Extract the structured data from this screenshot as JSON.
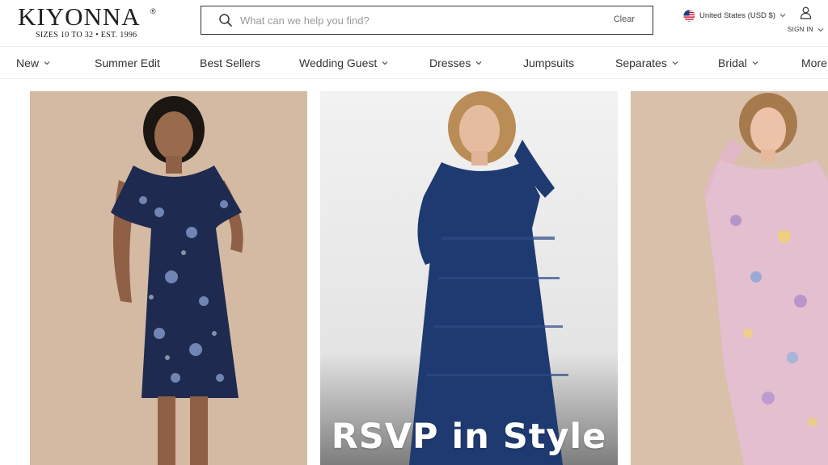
{
  "brand": {
    "name": "KIYONNA",
    "trademark": "®",
    "tagline": "SIZES 10 TO 32  •  EST. 1996"
  },
  "search": {
    "placeholder": "What can we help you find?",
    "value": "",
    "clear_label": "Clear"
  },
  "region": {
    "label": "United States (USD $)",
    "flag_icon": "us-flag-icon"
  },
  "account": {
    "label": "SIGN IN",
    "icon": "user-icon"
  },
  "nav": {
    "items": [
      {
        "label": "New",
        "has_dropdown": true
      },
      {
        "label": "Summer Edit",
        "has_dropdown": false
      },
      {
        "label": "Best Sellers",
        "has_dropdown": false
      },
      {
        "label": "Wedding Guest",
        "has_dropdown": true
      },
      {
        "label": "Dresses",
        "has_dropdown": true
      },
      {
        "label": "Jumpsuits",
        "has_dropdown": false
      },
      {
        "label": "Separates",
        "has_dropdown": true
      },
      {
        "label": "Bridal",
        "has_dropdown": true
      },
      {
        "label": "More",
        "has_dropdown": false
      }
    ]
  },
  "hero": {
    "headline": "RSVP in Style",
    "panels": [
      {
        "image": "model-navy-floral-wrap-dress",
        "background": "#d8bfa8"
      },
      {
        "image": "model-navy-lace-maxi-dress",
        "background": "#ececec"
      },
      {
        "image": "model-pink-floral-chiffon-dress",
        "background": "#d9c0aa"
      }
    ]
  },
  "colors": {
    "text": "#222222",
    "border": "#333333",
    "hero_text": "#ffffff"
  }
}
